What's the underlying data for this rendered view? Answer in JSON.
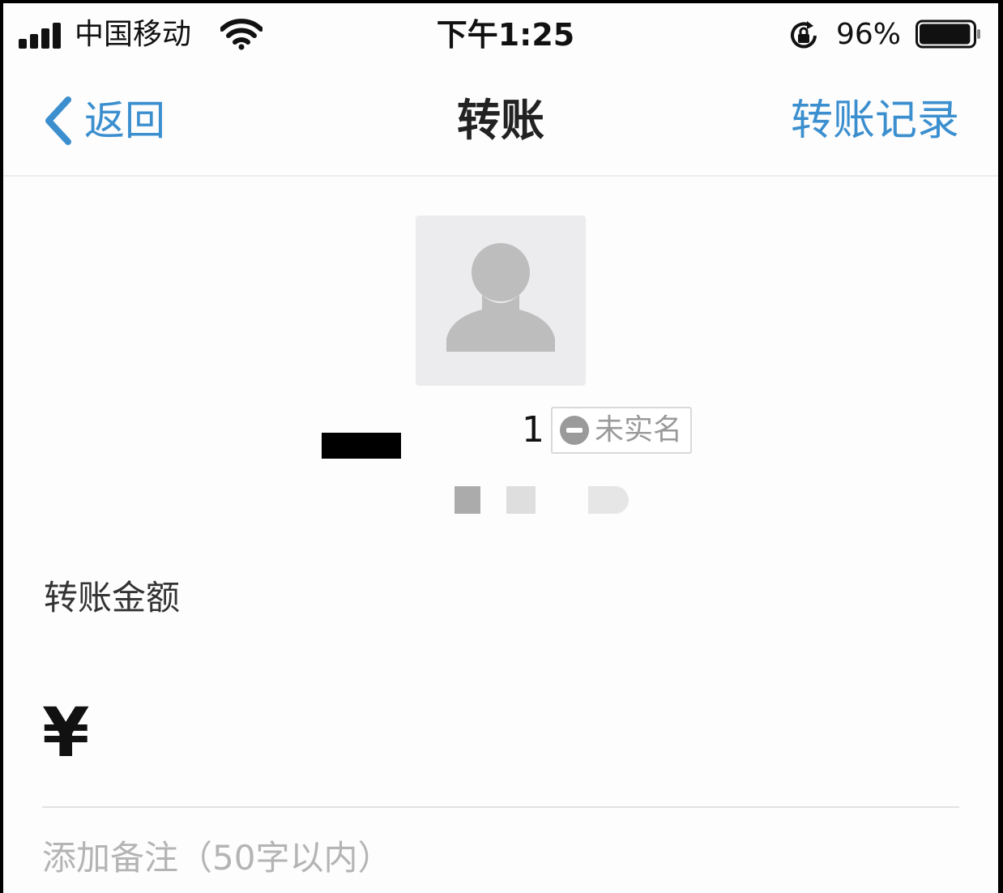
{
  "status_bar": {
    "carrier": "中国移动",
    "time": "下午1:25",
    "battery_percent": "96%",
    "battery_level": 0.96,
    "icons": [
      "signal-icon",
      "wifi-icon",
      "rotation-lock-icon",
      "battery-icon"
    ]
  },
  "nav": {
    "back_label": "返回",
    "title": "转账",
    "record_label": "转账记录"
  },
  "recipient": {
    "name_visible_tail": "1",
    "realname_status": "未实名"
  },
  "amount": {
    "label": "转账金额",
    "currency_symbol": "¥",
    "value": ""
  },
  "note": {
    "placeholder": "添加备注（50字以内）",
    "value": ""
  },
  "colors": {
    "accent_blue": "#3b8fcf",
    "background": "#fdfdfd",
    "avatar_bg": "#ececee",
    "avatar_figure": "#bdbdbd"
  }
}
